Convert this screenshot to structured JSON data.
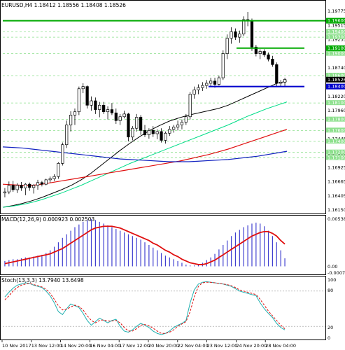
{
  "header": {
    "symbol": "EURUSD,H4",
    "open": "1.18412",
    "high": "1.18556",
    "low": "1.18408",
    "close": "1.18526"
  },
  "macd": {
    "label": "MACD(12,26,9)",
    "main": "0.000923",
    "signal": "0.002503",
    "axis_top": "0.005384",
    "axis_zero": "0.00",
    "axis_bottom": "-0.000748"
  },
  "stoch": {
    "label": "Stoch(13,3,3)",
    "main": "13.7940",
    "signal": "13.6498",
    "axis_top": "100",
    "axis_80": "80",
    "axis_20": "20",
    "axis_0": "0"
  },
  "price_axis": {
    "labels": [
      "1.19775",
      "1.19515",
      "1.19255",
      "1.18740",
      "1.18220",
      "1.17960",
      "1.17445",
      "1.17185",
      "1.16925",
      "1.16665",
      "1.16405",
      "1.16150"
    ],
    "top_marker": "1.19600",
    "current": "1.18526",
    "support": "1.18400",
    "resistance": "1.19100",
    "green_labels": [
      "1.19400",
      "1.19300",
      "1.19000",
      "1.18600",
      "1.18100",
      "1.17800",
      "1.17600",
      "1.17400",
      "1.17200",
      "1.17100"
    ]
  },
  "time_axis": [
    "10 Nov 2017",
    "13 Nov 12:00",
    "14 Nov 20:00",
    "16 Nov 04:00",
    "17 Nov 12:00",
    "20 Nov 20:00",
    "22 Nov 04:00",
    "23 Nov 12:00",
    "24 Nov 20:00",
    "28 Nov 04:00"
  ],
  "colors": {
    "bull": "#ffffff",
    "bear": "#000000",
    "ma_fast": "#000000",
    "ma_mid": "#00dd88",
    "ma_slow_red": "#e01010",
    "ma_slow_blue": "#1020c0",
    "level_green": "#00aa00",
    "level_dash": "#8ee08e",
    "support_line": "#0000cc",
    "macd_hist": "#4040d0",
    "macd_signal": "#e01010",
    "stoch_main": "#20b0b0",
    "stoch_signal": "#e01010"
  },
  "chart_data": {
    "type": "candlestick",
    "instrument": "EURUSD",
    "timeframe": "H4",
    "ylim": [
      1.1615,
      1.1985
    ],
    "candles": [
      [
        1.1646,
        1.1655,
        1.1638,
        1.1648
      ],
      [
        1.1648,
        1.1667,
        1.1644,
        1.166
      ],
      [
        1.166,
        1.1668,
        1.1648,
        1.1652
      ],
      [
        1.1652,
        1.1664,
        1.1646,
        1.166
      ],
      [
        1.166,
        1.1666,
        1.165,
        1.1655
      ],
      [
        1.1655,
        1.1664,
        1.1642,
        1.1662
      ],
      [
        1.1662,
        1.1665,
        1.165,
        1.1656
      ],
      [
        1.1656,
        1.1662,
        1.1645,
        1.166
      ],
      [
        1.166,
        1.167,
        1.1652,
        1.1665
      ],
      [
        1.1665,
        1.1668,
        1.1658,
        1.1662
      ],
      [
        1.1662,
        1.1672,
        1.166,
        1.167
      ],
      [
        1.167,
        1.1676,
        1.1665,
        1.1672
      ],
      [
        1.1672,
        1.168,
        1.1668,
        1.1676
      ],
      [
        1.1676,
        1.1702,
        1.1672,
        1.17
      ],
      [
        1.17,
        1.1738,
        1.1696,
        1.1734
      ],
      [
        1.1734,
        1.1778,
        1.1728,
        1.177
      ],
      [
        1.177,
        1.1795,
        1.1758,
        1.1788
      ],
      [
        1.1788,
        1.18,
        1.177,
        1.1794
      ],
      [
        1.1794,
        1.184,
        1.1788,
        1.1836
      ],
      [
        1.1836,
        1.1846,
        1.1828,
        1.184
      ],
      [
        1.184,
        1.1842,
        1.18,
        1.1806
      ],
      [
        1.1806,
        1.1822,
        1.1796,
        1.1814
      ],
      [
        1.1814,
        1.182,
        1.179,
        1.1798
      ],
      [
        1.1798,
        1.1812,
        1.1784,
        1.1806
      ],
      [
        1.1806,
        1.1812,
        1.179,
        1.1794
      ],
      [
        1.1794,
        1.1804,
        1.178,
        1.1798
      ],
      [
        1.1798,
        1.181,
        1.1788,
        1.1792
      ],
      [
        1.1792,
        1.18,
        1.1772,
        1.1778
      ],
      [
        1.1778,
        1.179,
        1.177,
        1.1785
      ],
      [
        1.1785,
        1.1796,
        1.1782,
        1.179
      ],
      [
        1.179,
        1.1792,
        1.174,
        1.1748
      ],
      [
        1.1748,
        1.1768,
        1.1742,
        1.1764
      ],
      [
        1.1764,
        1.179,
        1.1758,
        1.1784
      ],
      [
        1.1784,
        1.1788,
        1.1752,
        1.176
      ],
      [
        1.176,
        1.177,
        1.1748,
        1.1752
      ],
      [
        1.1752,
        1.1764,
        1.1745,
        1.176
      ],
      [
        1.176,
        1.1768,
        1.1748,
        1.1754
      ],
      [
        1.1754,
        1.1762,
        1.1744,
        1.1758
      ],
      [
        1.1758,
        1.1764,
        1.1738,
        1.1742
      ],
      [
        1.1742,
        1.1758,
        1.1736,
        1.1755
      ],
      [
        1.1755,
        1.1768,
        1.175,
        1.1762
      ],
      [
        1.1762,
        1.177,
        1.1756,
        1.1766
      ],
      [
        1.1766,
        1.1778,
        1.176,
        1.177
      ],
      [
        1.177,
        1.178,
        1.1762,
        1.1775
      ],
      [
        1.1775,
        1.179,
        1.177,
        1.1785
      ],
      [
        1.1785,
        1.183,
        1.178,
        1.1826
      ],
      [
        1.1826,
        1.184,
        1.1818,
        1.1834
      ],
      [
        1.1834,
        1.1844,
        1.1826,
        1.1838
      ],
      [
        1.1838,
        1.1848,
        1.1832,
        1.1842
      ],
      [
        1.1842,
        1.1852,
        1.1836,
        1.1846
      ],
      [
        1.1846,
        1.1856,
        1.184,
        1.185
      ],
      [
        1.185,
        1.1856,
        1.1838,
        1.1844
      ],
      [
        1.1844,
        1.186,
        1.1842,
        1.1856
      ],
      [
        1.1856,
        1.1906,
        1.1852,
        1.19
      ],
      [
        1.19,
        1.1935,
        1.189,
        1.1928
      ],
      [
        1.1928,
        1.1948,
        1.1918,
        1.194
      ],
      [
        1.194,
        1.1946,
        1.1925,
        1.193
      ],
      [
        1.193,
        1.1942,
        1.192,
        1.1936
      ],
      [
        1.1936,
        1.1968,
        1.1932,
        1.1962
      ],
      [
        1.1962,
        1.1976,
        1.195,
        1.196
      ],
      [
        1.196,
        1.1964,
        1.1905,
        1.1912
      ],
      [
        1.1912,
        1.1916,
        1.1895,
        1.19
      ],
      [
        1.19,
        1.1908,
        1.189,
        1.1904
      ],
      [
        1.1904,
        1.1908,
        1.1894,
        1.1898
      ],
      [
        1.1898,
        1.1902,
        1.1886,
        1.189
      ],
      [
        1.189,
        1.1896,
        1.1876,
        1.188
      ],
      [
        1.188,
        1.1884,
        1.184,
        1.1846
      ],
      [
        1.1846,
        1.1852,
        1.184,
        1.1848
      ],
      [
        1.1848,
        1.1856,
        1.1841,
        1.1853
      ]
    ],
    "levels": {
      "resistance_top": 1.196,
      "resistance": 1.191,
      "support": 1.184,
      "green_dashed": [
        1.194,
        1.193,
        1.19,
        1.186,
        1.181,
        1.178,
        1.176,
        1.174,
        1.172,
        1.171
      ]
    },
    "moving_averages": [
      {
        "color": "black",
        "values": [
          1.162,
          1.1623,
          1.1627,
          1.1632,
          1.1638,
          1.1645,
          1.1652,
          1.166,
          1.167,
          1.1682,
          1.1696,
          1.171,
          1.1724,
          1.1737,
          1.1749,
          1.176,
          1.1769,
          1.1777,
          1.1783,
          1.1788,
          1.1792,
          1.1796,
          1.18,
          1.1806,
          1.1814,
          1.1822,
          1.183,
          1.1838,
          1.1846,
          1.185
        ]
      },
      {
        "color": "green",
        "values": [
          1.162,
          1.1622,
          1.1625,
          1.1629,
          1.1634,
          1.164,
          1.1646,
          1.1653,
          1.166,
          1.1668,
          1.1676,
          1.1684,
          1.1692,
          1.17,
          1.1707,
          1.1714,
          1.1721,
          1.1728,
          1.1735,
          1.1742,
          1.1749,
          1.1756,
          1.1763,
          1.177,
          1.1778,
          1.1786,
          1.1793,
          1.18,
          1.1806,
          1.1812
        ]
      },
      {
        "color": "red",
        "values": [
          1.1662,
          1.1661,
          1.166,
          1.166,
          1.1662,
          1.1665,
          1.1668,
          1.1671,
          1.1674,
          1.1677,
          1.168,
          1.1683,
          1.1686,
          1.1689,
          1.1692,
          1.1695,
          1.1698,
          1.1701,
          1.1704,
          1.1708,
          1.1712,
          1.1716,
          1.1721,
          1.1726,
          1.1732,
          1.1738,
          1.1744,
          1.175,
          1.1756,
          1.1762
        ]
      },
      {
        "color": "blue",
        "values": [
          1.173,
          1.1729,
          1.1728,
          1.1726,
          1.1724,
          1.1722,
          1.172,
          1.1718,
          1.1716,
          1.1714,
          1.1712,
          1.171,
          1.1708,
          1.1707,
          1.1706,
          1.1705,
          1.1704,
          1.1703,
          1.1703,
          1.1703,
          1.1704,
          1.1705,
          1.1706,
          1.1707,
          1.1709,
          1.1711,
          1.1713,
          1.1716,
          1.1719,
          1.1722
        ]
      }
    ],
    "macd_histogram": [
      0.0006,
      0.0007,
      0.0008,
      0.0008,
      0.0009,
      0.001,
      0.001,
      0.0011,
      0.0012,
      0.0013,
      0.0015,
      0.0018,
      0.0022,
      0.0027,
      0.0032,
      0.0036,
      0.004,
      0.0044,
      0.0047,
      0.005,
      0.0052,
      0.0053,
      0.0052,
      0.005,
      0.0048,
      0.0046,
      0.0044,
      0.0042,
      0.004,
      0.0038,
      0.0036,
      0.0034,
      0.0032,
      0.003,
      0.0027,
      0.0024,
      0.0021,
      0.0018,
      0.0015,
      0.0012,
      0.001,
      0.0008,
      0.0006,
      0.0004,
      0.0002,
      0.0001,
      0.0001,
      0.0002,
      0.0004,
      0.0007,
      0.001,
      0.0014,
      0.0019,
      0.0024,
      0.0029,
      0.0034,
      0.0038,
      0.0041,
      0.0044,
      0.0046,
      0.0048,
      0.0049,
      0.0048,
      0.0045,
      0.004,
      0.0034,
      0.0027,
      0.0018,
      0.0009
    ],
    "macd_signal": [
      0.0003,
      0.0004,
      0.0005,
      0.0006,
      0.0007,
      0.0008,
      0.0009,
      0.001,
      0.0011,
      0.0012,
      0.0013,
      0.0014,
      0.0016,
      0.0018,
      0.002,
      0.0023,
      0.0026,
      0.0029,
      0.0032,
      0.0035,
      0.0038,
      0.0041,
      0.0043,
      0.0044,
      0.0045,
      0.0045,
      0.0045,
      0.0044,
      0.0043,
      0.0041,
      0.0039,
      0.0037,
      0.0035,
      0.0033,
      0.0031,
      0.0029,
      0.0026,
      0.0024,
      0.0021,
      0.0018,
      0.0016,
      0.0013,
      0.0011,
      0.0008,
      0.0006,
      0.0004,
      0.0003,
      0.0002,
      0.0002,
      0.0003,
      0.0005,
      0.0007,
      0.001,
      0.0013,
      0.0016,
      0.0019,
      0.0022,
      0.0025,
      0.0028,
      0.0031,
      0.0034,
      0.0036,
      0.0038,
      0.0039,
      0.0039,
      0.0037,
      0.0034,
      0.0029,
      0.0025
    ],
    "stoch_main": [
      70,
      78,
      85,
      90,
      92,
      94,
      93,
      90,
      88,
      86,
      80,
      72,
      60,
      45,
      40,
      50,
      58,
      55,
      52,
      42,
      30,
      22,
      28,
      34,
      30,
      26,
      30,
      32,
      20,
      12,
      10,
      14,
      20,
      25,
      22,
      18,
      12,
      8,
      6,
      8,
      12,
      18,
      22,
      25,
      30,
      60,
      82,
      92,
      95,
      96,
      95,
      94,
      93,
      92,
      90,
      88,
      84,
      80,
      78,
      76,
      74,
      72,
      60,
      50,
      42,
      35,
      25,
      18,
      14
    ],
    "stoch_signal": [
      65,
      72,
      80,
      86,
      90,
      92,
      93,
      91,
      89,
      87,
      83,
      76,
      66,
      55,
      48,
      49,
      53,
      56,
      54,
      48,
      38,
      30,
      26,
      30,
      31,
      29,
      29,
      30,
      26,
      18,
      12,
      12,
      16,
      22,
      23,
      21,
      17,
      12,
      8,
      8,
      10,
      14,
      20,
      24,
      28,
      45,
      70,
      88,
      94,
      95,
      95,
      94,
      93,
      92,
      91,
      89,
      86,
      82,
      80,
      78,
      76,
      74,
      66,
      56,
      46,
      38,
      30,
      22,
      16
    ]
  }
}
